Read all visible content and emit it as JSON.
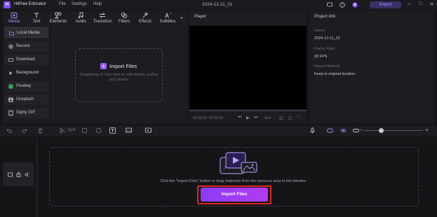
{
  "app": {
    "name": "HitPaw Edimakor",
    "project_title": "2024-12-11_01",
    "export_label": "Export"
  },
  "menu": [
    "File",
    "Settings",
    "Help"
  ],
  "tabs": [
    {
      "label": "Media",
      "icon": "media-icon",
      "active": true
    },
    {
      "label": "Text",
      "icon": "text-icon"
    },
    {
      "label": "Elements",
      "icon": "elements-icon"
    },
    {
      "label": "Audio",
      "icon": "audio-icon"
    },
    {
      "label": "Transition",
      "icon": "transition-icon"
    },
    {
      "label": "Filters",
      "icon": "filters-icon"
    },
    {
      "label": "Effects",
      "icon": "effects-icon"
    },
    {
      "label": "Subtitles",
      "icon": "subtitles-icon"
    }
  ],
  "sidebar": {
    "items": [
      {
        "label": "Local Media",
        "icon": "folder-icon",
        "active": true
      },
      {
        "label": "Record",
        "icon": "record-icon"
      },
      {
        "label": "Download",
        "icon": "download-icon"
      },
      {
        "label": "Background",
        "icon": "triangle-right-icon"
      },
      {
        "label": "Pixabay",
        "icon": "pixabay-icon"
      },
      {
        "label": "Unsplash",
        "icon": "unsplash-icon"
      },
      {
        "label": "Giphy GIF",
        "icon": "giphy-icon"
      }
    ]
  },
  "media": {
    "import_title": "Import Files",
    "import_desc": "Drag&drop or click here to add videos, audios and photos."
  },
  "player": {
    "title": "Player",
    "time_current": "00:00:00",
    "time_total": "00:00:00",
    "speed": "1x"
  },
  "project_info": {
    "title": "Project Info",
    "name_label": "Name:",
    "name_value": "2024-12-11_01",
    "fps_label": "Frame Rate:",
    "fps_value": "30 FPS",
    "import_label": "Import Method:",
    "import_value": "Keep in original location"
  },
  "timeline": {
    "split_label": "Split",
    "drop_hint": "Click the \"Import Files\" button or drag materials from the resource area to the timeline.",
    "import_button": "Import Files"
  },
  "colors": {
    "accent": "#9b5cf6",
    "highlight": "#e02424",
    "background": "#151518"
  }
}
